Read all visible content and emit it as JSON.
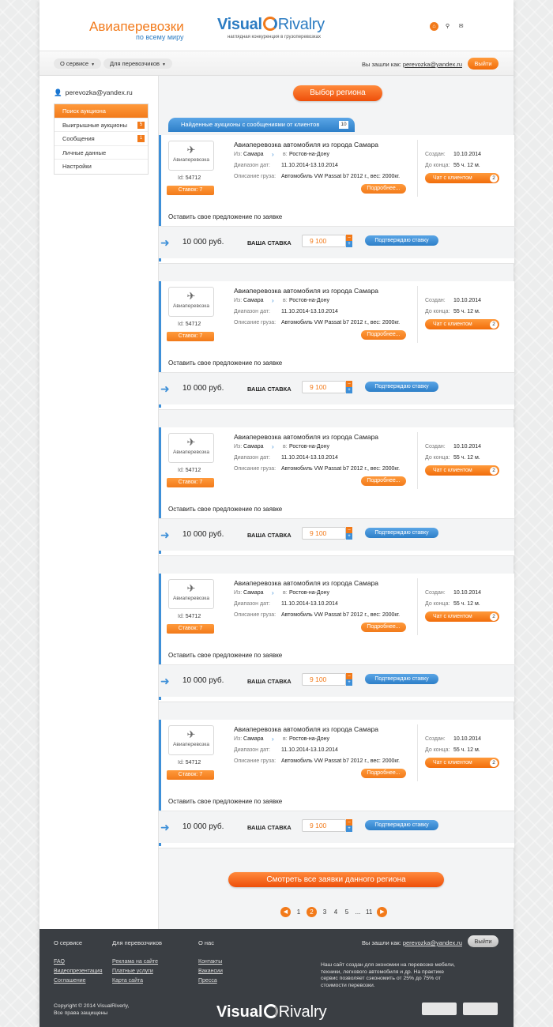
{
  "header": {
    "brand_title": "Авиаперевозки",
    "brand_subtitle": "по всему миру",
    "logo_word1": "Visual",
    "logo_word2": "Rivalry",
    "logo_tagline": "наглядная конкуренция в грузоперевозках",
    "icons": [
      "home-icon",
      "search-icon",
      "mail-icon"
    ]
  },
  "nav": {
    "menu1": "О сервисе",
    "menu2": "Для перевозчиков",
    "logged_label": "Вы зашли как:",
    "logged_email": "perevozka@yandex.ru",
    "exit": "Выйти"
  },
  "sidebar": {
    "user_email": "perevozka@yandex.ru",
    "items": [
      {
        "label": "Поиск аукциона",
        "badge": ""
      },
      {
        "label": "Выигрышные аукционы",
        "badge": "5"
      },
      {
        "label": "Сообщения",
        "badge": "1"
      },
      {
        "label": "Личные данные",
        "badge": ""
      },
      {
        "label": "Настройки",
        "badge": ""
      }
    ]
  },
  "main": {
    "region_button": "Выбор региона",
    "found_tab": "Найденные аукционы с сообщениями от клиентов",
    "found_count": "10",
    "all_button": "Смотреть все заявки данного региона"
  },
  "auctions": [
    {
      "title": "Авиаперевозка автомобиля из города Самара",
      "thumb": "Авиаперевозка",
      "id_label": "Id:",
      "id": "54712",
      "bids": "Ставок: 7",
      "from_label": "Из:",
      "from": "Самара",
      "to_label": "в:",
      "to": "Ростов-на-Дону",
      "dates_label": "Диапазон дат:",
      "dates": "11.10.2014-13.10.2014",
      "cargo_label": "Описание груза:",
      "cargo": "Автомобиль VW Passat b7 2012 г., вес: 2000кг.",
      "more": "Подробнее...",
      "created_label": "Создан:",
      "created": "10.10.2014",
      "end_label": "До конца:",
      "end": "55 ч. 12 м.",
      "chat": "Чат с клиентом",
      "chat_count": "2",
      "offer_title": "Оставить свое предложение по заявке",
      "price": "10 000 руб.",
      "bid_label": "ВАША СТАВКА",
      "bid_value": "9 100",
      "confirm": "Подтверждаю ставку"
    },
    {
      "title": "Авиаперевозка автомобиля из города Самара",
      "thumb": "Авиаперевозка",
      "id_label": "Id:",
      "id": "54712",
      "bids": "Ставок: 7",
      "from_label": "Из:",
      "from": "Самара",
      "to_label": "в:",
      "to": "Ростов-на-Дону",
      "dates_label": "Диапазон дат:",
      "dates": "11.10.2014-13.10.2014",
      "cargo_label": "Описание груза:",
      "cargo": "Автомобиль VW Passat b7 2012 г., вес: 2000кг.",
      "more": "Подробнее...",
      "created_label": "Создан:",
      "created": "10.10.2014",
      "end_label": "До конца:",
      "end": "55 ч. 12 м.",
      "chat": "Чат с клиентом",
      "chat_count": "2",
      "offer_title": "Оставить свое предложение по заявке",
      "price": "10 000 руб.",
      "bid_label": "ВАША СТАВКА",
      "bid_value": "9 100",
      "confirm": "Подтверждаю ставку"
    },
    {
      "title": "Авиаперевозка автомобиля из города Самара",
      "thumb": "Авиаперевозка",
      "id_label": "Id:",
      "id": "54712",
      "bids": "Ставок: 7",
      "from_label": "Из:",
      "from": "Самара",
      "to_label": "в:",
      "to": "Ростов-на-Дону",
      "dates_label": "Диапазон дат:",
      "dates": "11.10.2014-13.10.2014",
      "cargo_label": "Описание груза:",
      "cargo": "Автомобиль VW Passat b7 2012 г., вес: 2000кг.",
      "more": "Подробнее...",
      "created_label": "Создан:",
      "created": "10.10.2014",
      "end_label": "До конца:",
      "end": "55 ч. 12 м.",
      "chat": "Чат с клиентом",
      "chat_count": "2",
      "offer_title": "Оставить свое предложение по заявке",
      "price": "10 000 руб.",
      "bid_label": "ВАША СТАВКА",
      "bid_value": "9 100",
      "confirm": "Подтверждаю ставку"
    },
    {
      "title": "Авиаперевозка автомобиля из города Самара",
      "thumb": "Авиаперевозка",
      "id_label": "Id:",
      "id": "54712",
      "bids": "Ставок: 7",
      "from_label": "Из:",
      "from": "Самара",
      "to_label": "в:",
      "to": "Ростов-на-Дону",
      "dates_label": "Диапазон дат:",
      "dates": "11.10.2014-13.10.2014",
      "cargo_label": "Описание груза:",
      "cargo": "Автомобиль VW Passat b7 2012 г., вес: 2000кг.",
      "more": "Подробнее...",
      "created_label": "Создан:",
      "created": "10.10.2014",
      "end_label": "До конца:",
      "end": "55 ч. 12 м.",
      "chat": "Чат с клиентом",
      "chat_count": "2",
      "offer_title": "Оставить свое предложение по заявке",
      "price": "10 000 руб.",
      "bid_label": "ВАША СТАВКА",
      "bid_value": "9 100",
      "confirm": "Подтверждаю ставку"
    },
    {
      "title": "Авиаперевозка автомобиля из города Самара",
      "thumb": "Авиаперевозка",
      "id_label": "Id:",
      "id": "54712",
      "bids": "Ставок: 7",
      "from_label": "Из:",
      "from": "Самара",
      "to_label": "в:",
      "to": "Ростов-на-Дону",
      "dates_label": "Диапазон дат:",
      "dates": "11.10.2014-13.10.2014",
      "cargo_label": "Описание груза:",
      "cargo": "Автомобиль VW Passat b7 2012 г., вес: 2000кг.",
      "more": "Подробнее...",
      "created_label": "Создан:",
      "created": "10.10.2014",
      "end_label": "До конца:",
      "end": "55 ч. 12 м.",
      "chat": "Чат с клиентом",
      "chat_count": "2",
      "offer_title": "Оставить свое предложение по заявке",
      "price": "10 000 руб.",
      "bid_label": "ВАША СТАВКА",
      "bid_value": "9 100",
      "confirm": "Подтверждаю ставку"
    }
  ],
  "pagination": {
    "pages": [
      "1",
      "2",
      "3",
      "4",
      "5",
      "...",
      "11"
    ],
    "active_page": "2"
  },
  "footer": {
    "top": [
      "О сервисе",
      "Для перевозчиков",
      "О нас"
    ],
    "logged_label": "Вы зашли как:",
    "logged_email": "perevozka@yandex.ru",
    "exit": "Выйти",
    "col1": [
      "FAQ",
      "Видеопрезентация",
      "Соглашение"
    ],
    "col2": [
      "Реклама на сайте",
      "Платные услуги",
      "Карта сайта"
    ],
    "col3": [
      "Контакты",
      "Вакансии",
      "Пресса"
    ],
    "description": "Наш сайт создан для экономии на перевозке мебели, техники, легкового автомобиля и др. На практике сервис позволяет сэкономить от 25% до 75% от стоимости перевозки.",
    "copyright1": "Copyright © 2014 VisualRiverly,",
    "copyright2": "Все права защищены",
    "logo_word1": "Visual",
    "logo_word2": "Rivalry"
  },
  "colors": {
    "accent": "#f27a1a",
    "brand_blue": "#2c7cc2",
    "footer_bg": "#3a3e43"
  }
}
